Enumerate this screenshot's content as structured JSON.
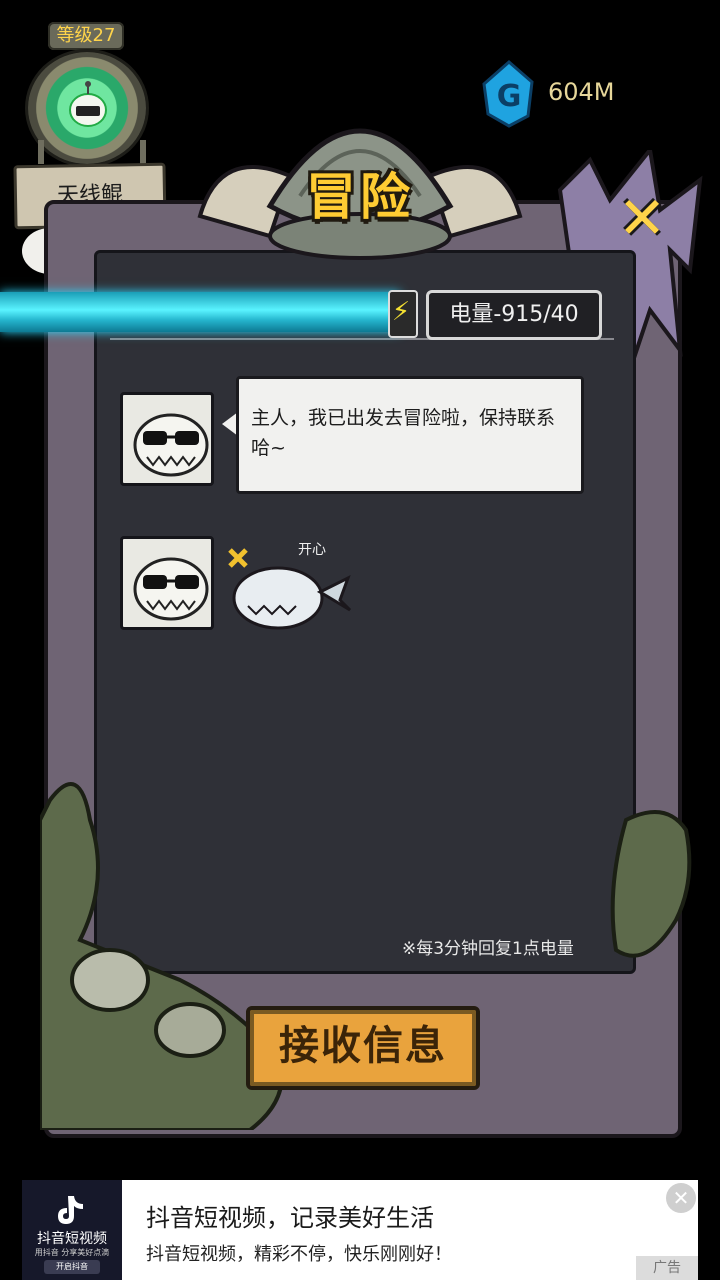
{
  "player": {
    "level_label": "等级27",
    "pet_name": "天线鲲",
    "alert_mark": "!"
  },
  "currency": {
    "icon": "gem-icon",
    "value": "604M"
  },
  "panel": {
    "title": "冒险",
    "close_label": "✕",
    "channel_title": "",
    "energy_label": "电量-915/40",
    "energy_bar_fill": 1.0,
    "regen_note": "※每3分钟回复1点电量"
  },
  "chat": {
    "messages": [
      {
        "type": "text",
        "text": "主人，我已出发去冒险啦，保持联系哈~"
      },
      {
        "type": "sticker",
        "sticker_text": "开心",
        "sticker": "happy-whale-sticker"
      }
    ]
  },
  "actions": {
    "receive_label": "接收信息"
  },
  "ad": {
    "logo_name": "抖音短视频",
    "logo_sub": "用抖音 分享美好点滴",
    "logo_button": "开启抖音",
    "title": "抖音短视频，记录美好生活",
    "description": "抖音短视频，精彩不停，快乐刚刚好！",
    "close": "✕",
    "label": "广告"
  },
  "colors": {
    "energy_bar": "#5af3ff",
    "title": "#ffcc33",
    "button": "#e9a33d",
    "frame": "#6f6474"
  }
}
